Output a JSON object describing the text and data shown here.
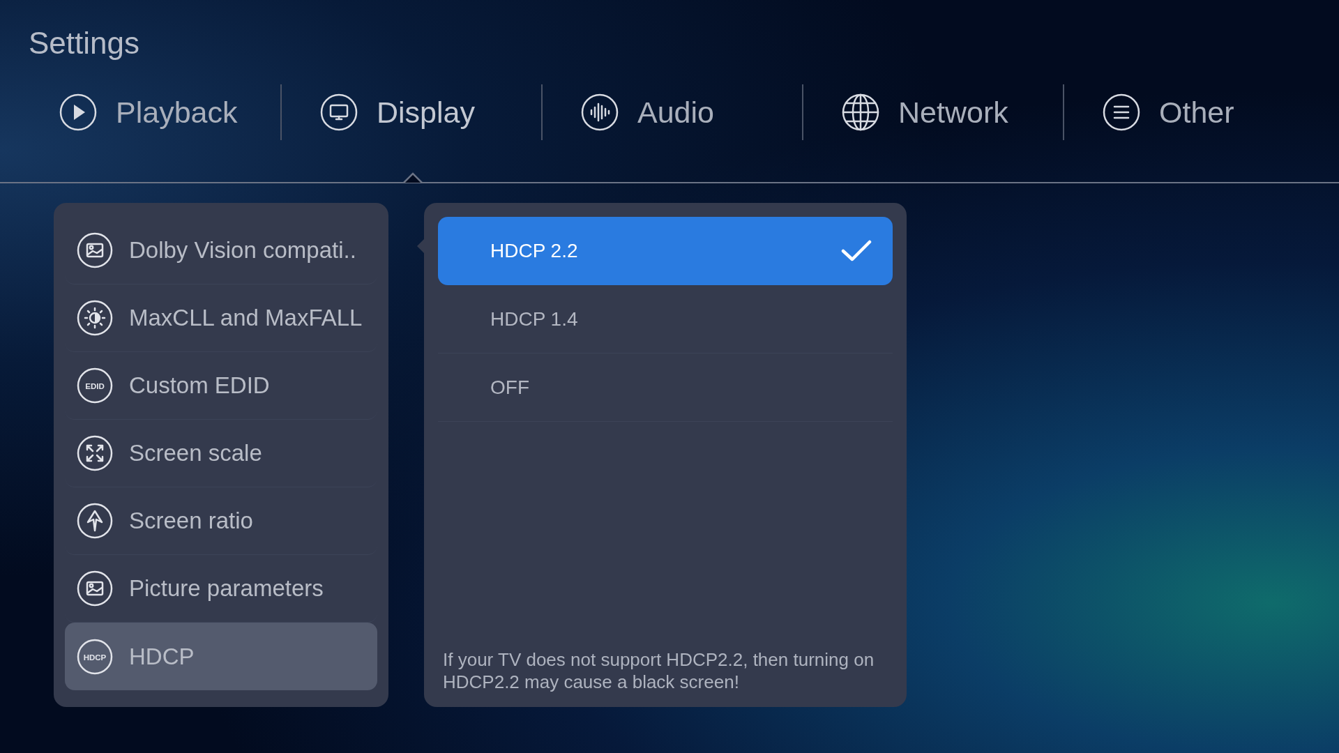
{
  "title": "Settings",
  "tabs": [
    {
      "label": "Playback",
      "selected": false
    },
    {
      "label": "Display",
      "selected": true
    },
    {
      "label": "Audio",
      "selected": false
    },
    {
      "label": "Network",
      "selected": false
    },
    {
      "label": "Other",
      "selected": false
    }
  ],
  "menu": [
    {
      "label": "Dolby Vision compati..",
      "selected": false
    },
    {
      "label": "MaxCLL and MaxFALL",
      "selected": false
    },
    {
      "label": "Custom EDID",
      "selected": false,
      "badge": "EDID"
    },
    {
      "label": "Screen scale",
      "selected": false
    },
    {
      "label": "Screen ratio",
      "selected": false
    },
    {
      "label": "Picture parameters",
      "selected": false
    },
    {
      "label": "HDCP",
      "selected": true,
      "badge": "HDCP"
    }
  ],
  "options": [
    {
      "label": "HDCP 2.2",
      "selected": true
    },
    {
      "label": "HDCP 1.4",
      "selected": false
    },
    {
      "label": "OFF",
      "selected": false
    }
  ],
  "note": "If your TV does not support HDCP2.2, then turning on HDCP2.2 may cause a black screen!"
}
